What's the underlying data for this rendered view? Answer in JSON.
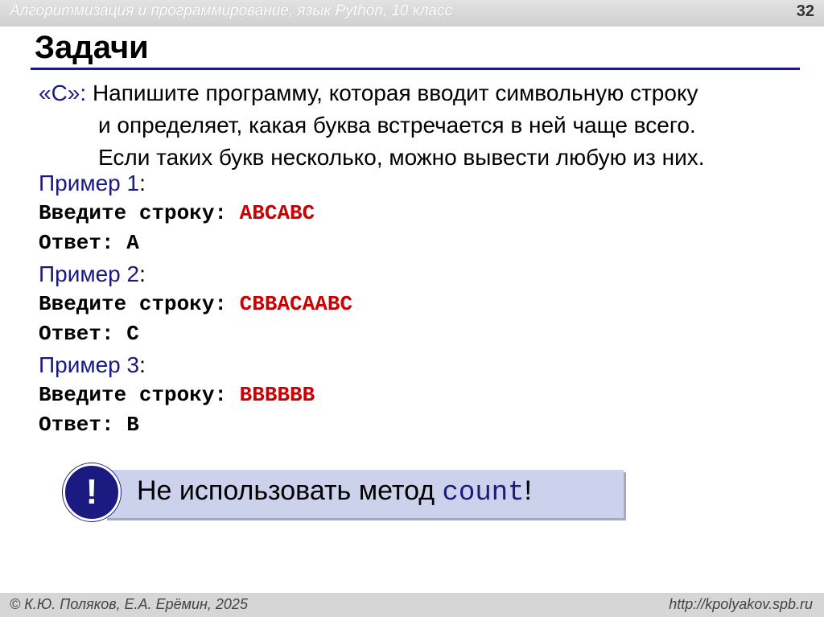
{
  "header": {
    "course": "Алгоритмизация и программирование, язык Python, 10 класс",
    "slide_number": "32"
  },
  "title": "Задачи",
  "task": {
    "label": "«C»:",
    "lines": [
      "Напишите программу, которая вводит символьную строку",
      "и определяет, какая буква встречается в ней чаще всего.",
      "Если таких букв несколько, можно вывести любую из них."
    ]
  },
  "examples": [
    {
      "title": "Пример 1",
      "prompt": "Введите строку: ",
      "input": "ABCABC",
      "answer": "Ответ: A"
    },
    {
      "title": "Пример 2",
      "prompt": "Введите строку: ",
      "input": "CBBACAABC",
      "answer": "Ответ: C"
    },
    {
      "title": "Пример 3",
      "prompt": "Введите строку: ",
      "input": "BBBBBB",
      "answer": "Ответ: B"
    }
  ],
  "notice": {
    "icon": "exclamation-icon",
    "symbol": "!",
    "text": "Не использовать метод ",
    "code": "count",
    "end": "!"
  },
  "footer": {
    "copyright": "© К.Ю. Поляков, Е.А. Ерёмин, 2025",
    "url": "http://kpolyakov.spb.ru"
  },
  "colors": {
    "accent": "#1a1a80",
    "input": "#cc0000",
    "notice_bg": "#cdd2ec"
  }
}
